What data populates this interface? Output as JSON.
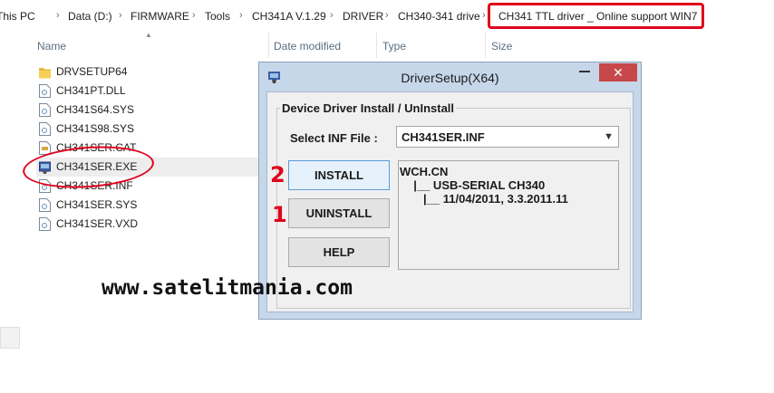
{
  "breadcrumb": [
    "This PC",
    "Data (D:)",
    "FIRMWARE",
    "Tools",
    "CH341A V.1.29",
    "DRIVER",
    "CH340-341 drive",
    "CH341 TTL driver _ Online support WIN7"
  ],
  "columns": {
    "name": "Name",
    "date_modified": "Date modified",
    "type": "Type",
    "size": "Size"
  },
  "files": [
    {
      "name": "DRVSETUP64",
      "icon": "folder-icon"
    },
    {
      "name": "CH341PT.DLL",
      "icon": "file-icon"
    },
    {
      "name": "CH341S64.SYS",
      "icon": "file-icon"
    },
    {
      "name": "CH341S98.SYS",
      "icon": "file-icon"
    },
    {
      "name": "CH341SER.CAT",
      "icon": "file-icon"
    },
    {
      "name": "CH341SER.EXE",
      "icon": "installer-icon"
    },
    {
      "name": "CH341SER.INF",
      "icon": "file-icon"
    },
    {
      "name": "CH341SER.SYS",
      "icon": "file-icon"
    },
    {
      "name": "CH341SER.VXD",
      "icon": "file-icon"
    }
  ],
  "dialog": {
    "title": "DriverSetup(X64)",
    "close_glyph": "✕",
    "group_title": "Device Driver Install / UnInstall",
    "inf_label": "Select INF File :",
    "inf_value": "CH341SER.INF",
    "buttons": {
      "install": "INSTALL",
      "uninstall": "UNINSTALL",
      "help": "HELP"
    },
    "info_lines": [
      "WCH.CN",
      "  |__ USB-SERIAL CH340",
      "     |__ 11/04/2011, 3.3.2011.11"
    ]
  },
  "annotations": {
    "step_install": "2",
    "step_uninstall": "1",
    "watermark": "www.satelitmania.com"
  },
  "colors": {
    "highlight": "#e0001a",
    "close_button": "#c7484a",
    "dialog_frame": "#c7d7ea"
  }
}
